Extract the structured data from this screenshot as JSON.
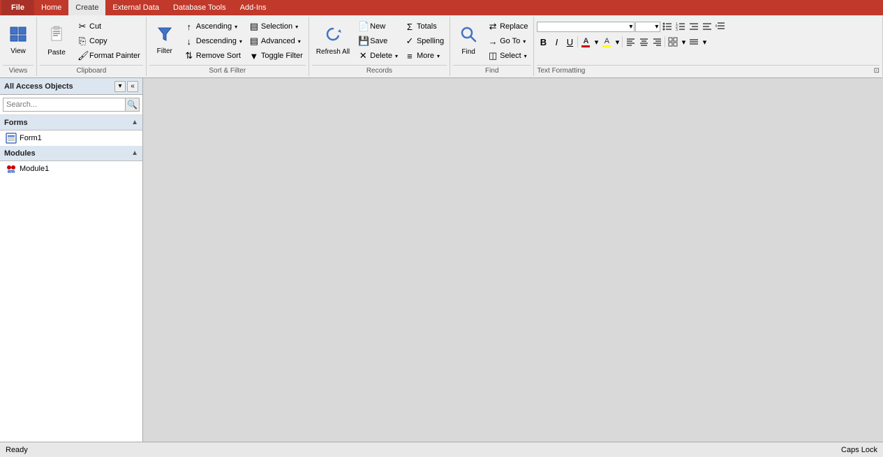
{
  "ribbon_tabs": {
    "file": "File",
    "home": "Home",
    "create": "Create",
    "external_data": "External Data",
    "database_tools": "Database Tools",
    "add_ins": "Add-Ins"
  },
  "groups": {
    "views": {
      "label": "Views",
      "view_btn": "View"
    },
    "clipboard": {
      "label": "Clipboard",
      "paste": "Paste",
      "cut": "Cut",
      "copy": "Copy",
      "format_painter": "Format Painter"
    },
    "sort_filter": {
      "label": "Sort & Filter",
      "ascending": "Ascending",
      "descending": "Descending",
      "remove_sort": "Remove Sort",
      "filter": "Filter",
      "selection": "Selection",
      "advanced": "Advanced",
      "toggle_filter": "Toggle Filter"
    },
    "records": {
      "label": "Records",
      "refresh_all": "Refresh\nAll",
      "new": "New",
      "save": "Save",
      "delete": "Delete",
      "totals": "Totals",
      "spelling": "Spelling",
      "more": "More"
    },
    "find": {
      "label": "Find",
      "find": "Find",
      "replace": "Replace",
      "go_to": "Go To",
      "select": "Select"
    },
    "text_formatting": {
      "label": "Text Formatting",
      "bold": "B",
      "italic": "I",
      "underline": "U",
      "font_color": "A",
      "highlight": "A",
      "align_left": "≡",
      "align_center": "≡",
      "align_right": "≡",
      "grid": "⊞",
      "lines": "≡"
    }
  },
  "sidebar": {
    "title": "All Access Objects",
    "search_placeholder": "Search...",
    "sections": [
      {
        "name": "Forms",
        "items": [
          {
            "name": "Form1",
            "type": "form"
          }
        ]
      },
      {
        "name": "Modules",
        "items": [
          {
            "name": "Module1",
            "type": "module"
          }
        ]
      }
    ]
  },
  "status_bar": {
    "ready": "Ready",
    "caps_lock": "Caps Lock"
  }
}
